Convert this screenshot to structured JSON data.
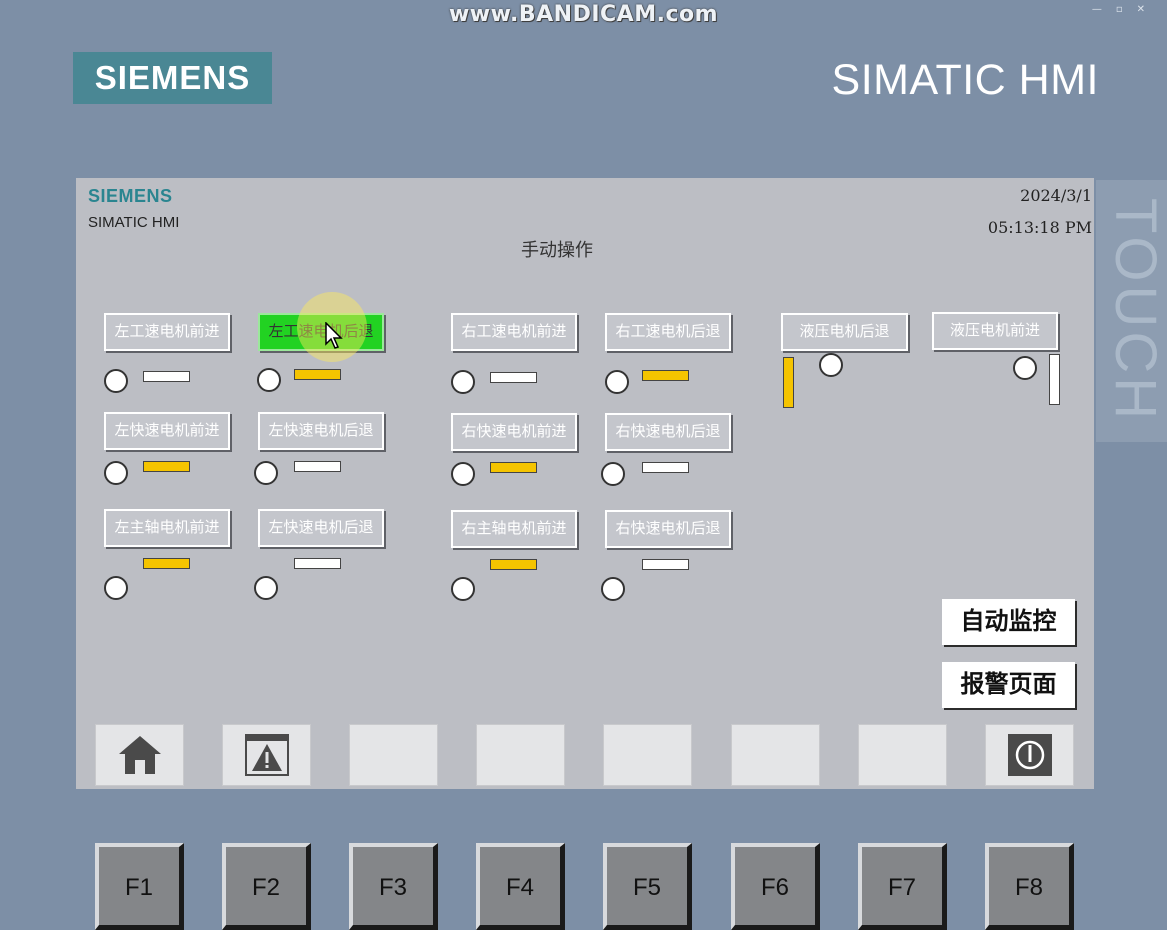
{
  "watermark": "www.BANDICAM.com",
  "bezel": {
    "brand": "SIEMENS",
    "product": "SIMATIC HMI",
    "touch_label": "TOUCH"
  },
  "screen": {
    "brand": "SIEMENS",
    "product": "SIMATIC HMI",
    "date": "2024/3/1",
    "time": "05:13:18 PM",
    "title": "手动操作"
  },
  "colors": {
    "bar_on": "#f5c400",
    "bar_off": "#ffffff",
    "active_button": "#22d222"
  },
  "buttons": {
    "left_work_fwd": "左工速电机前进",
    "left_work_back": "左工速电机后退",
    "right_work_fwd": "右工速电机前进",
    "right_work_back": "右工速电机后退",
    "hydraulic_back": "液压电机后退",
    "hydraulic_fwd": "液压电机前进",
    "left_fast_fwd": "左快速电机前进",
    "left_fast_back": "左快速电机后退",
    "right_fast_fwd": "右快速电机前进",
    "right_fast_back": "右快速电机后退",
    "left_spindle_fwd": "左主轴电机前进",
    "left_fast_back_2": "左快速电机后退",
    "right_spindle_fwd": "右主轴电机前进",
    "right_fast_back_2": "右快速电机后退"
  },
  "indicators": {
    "left_work_fwd": "off",
    "left_work_back": "on",
    "right_work_fwd": "off",
    "right_work_back": "on",
    "hydraulic_back": "on",
    "hydraulic_fwd": "off",
    "left_fast_fwd": "on",
    "left_fast_back": "off",
    "right_fast_fwd": "on",
    "right_fast_back": "off",
    "left_spindle_fwd": "on",
    "left_fast_back_2": "off",
    "right_spindle_fwd": "on",
    "right_fast_back_2": "off"
  },
  "nav": {
    "auto_monitor": "自动监控",
    "alarm_page": "报警页面"
  },
  "function_bar": [
    "home-icon",
    "alarm-icon",
    "",
    "",
    "",
    "",
    "",
    "power-icon"
  ],
  "function_keys": [
    "F1",
    "F2",
    "F3",
    "F4",
    "F5",
    "F6",
    "F7",
    "F8"
  ]
}
